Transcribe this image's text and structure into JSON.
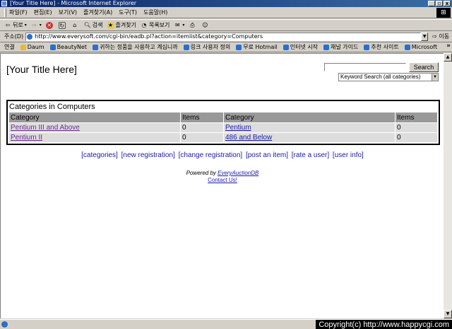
{
  "window": {
    "title": "[Your Title Here] - Microsoft Internet Explorer",
    "buttons": [
      "_",
      "▫",
      "x"
    ]
  },
  "menu": [
    "파일(F)",
    "편집(E)",
    "보기(V)",
    "즐겨찾기(A)",
    "도구(T)",
    "도움말(H)"
  ],
  "toolbar": {
    "back": "뒤로",
    "search": "검색",
    "favorites": "즐겨찾기",
    "history": "목록보기"
  },
  "address": {
    "label": "주소(D)",
    "url": "http://www.everysoft.com/cgi-bin/eadb.pl?action=itemlist&category=Computers",
    "go": "이동"
  },
  "links": {
    "label": "연결",
    "items": [
      "Daum",
      "BeautyNet",
      "귀하는 정품을 사용하고 계십니까",
      "링크 사용자 정의",
      "무료 Hotmail",
      "인터넷 시작",
      "채널 가이드",
      "추천 사이트",
      "Microsoft"
    ],
    "more": "»"
  },
  "page": {
    "heading": "[Your Title Here]",
    "search_button": "Search",
    "search_select": "Keyword Search (all categories)",
    "box_title": "Categories in Computers",
    "columns": [
      "Category",
      "Items",
      "Category",
      "Items"
    ],
    "rows": [
      [
        "Pentium III and Above",
        "0",
        "Pentium",
        "0"
      ],
      [
        "Pentium II",
        "0",
        "486 and Below",
        "0"
      ]
    ],
    "nav": [
      "[categories]",
      "[new registration]",
      "[change registration]",
      "[post an item]",
      "[rate a user]",
      "[user info]"
    ],
    "powered_prefix": "Powered by ",
    "powered_link": "EveryAuctionDB",
    "contact": "Contact Us!"
  },
  "status": {
    "copyright": "Copyright(c) http://www.happycgi.com"
  }
}
